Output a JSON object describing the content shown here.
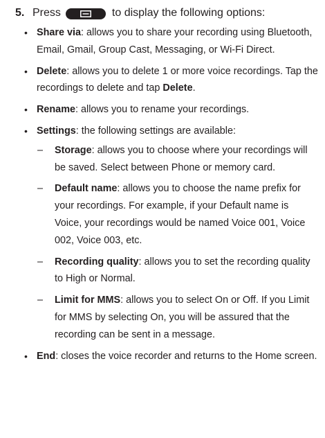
{
  "step": {
    "number": "5.",
    "before_key": "Press",
    "key_icon": "menu-key-icon",
    "after_key": "to display the following options:"
  },
  "options": [
    {
      "term": "Share via",
      "desc": ": allows you to share your recording using Bluetooth, Email, Gmail, Group Cast, Messaging, or Wi-Fi Direct."
    },
    {
      "term": "Delete",
      "desc": ": allows you to delete 1 or more voice recordings. Tap the recordings to delete and tap ",
      "term2": "Delete",
      "desc2": "."
    },
    {
      "term": "Rename",
      "desc": ": allows you to rename your recordings."
    },
    {
      "term": "Settings",
      "desc": ": the following settings are available:",
      "sub": [
        {
          "term": "Storage",
          "desc": ": allows you to choose where your recordings will be saved. Select between Phone or memory card."
        },
        {
          "term": "Default name",
          "desc": ": allows you to choose the name prefix for your recordings. For example, if your Default name is Voice, your recordings would be named Voice 001, Voice 002, Voice 003, etc."
        },
        {
          "term": "Recording quality",
          "desc": ": allows you to set the recording quality to High or Normal."
        },
        {
          "term": "Limit for MMS",
          "desc": ": allows you to select On or Off. If you Limit for MMS by selecting On, you will be assured that the recording can be sent in a message."
        }
      ]
    },
    {
      "term": "End",
      "desc": ": closes the voice recorder and returns to the Home screen."
    }
  ],
  "glyphs": {
    "bullet": "•",
    "dash": "–"
  }
}
